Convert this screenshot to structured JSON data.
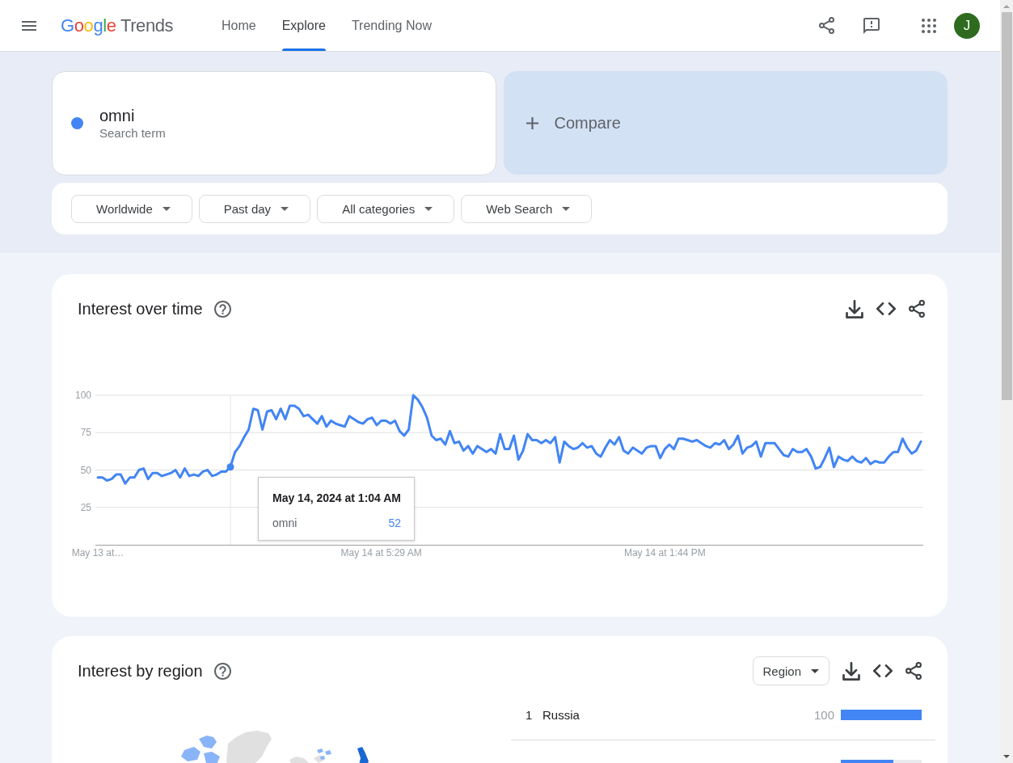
{
  "header": {
    "logo": {
      "brand": "Google",
      "product": "Trends"
    },
    "tabs": [
      {
        "label": "Home",
        "selected": false
      },
      {
        "label": "Explore",
        "selected": true
      },
      {
        "label": "Trending Now",
        "selected": false
      }
    ],
    "avatar": {
      "initial": "J"
    }
  },
  "search": {
    "terms": [
      {
        "term": "omni",
        "caption": "Search term",
        "color": "#4285f4"
      }
    ],
    "compare": {
      "label": "Compare"
    },
    "filters": [
      "Worldwide",
      "Past day",
      "All categories",
      "Web Search"
    ]
  },
  "interest_over_time": {
    "title": "Interest over time",
    "chart_data": {
      "type": "line",
      "grid": true,
      "categories": [
        "May 13 at…",
        null,
        null,
        null,
        null,
        null,
        null,
        null,
        null,
        null,
        null,
        null,
        null,
        null,
        null,
        null,
        null,
        null,
        null,
        null,
        null,
        null,
        null,
        null,
        null,
        null,
        null,
        null,
        null,
        null,
        null,
        null,
        null,
        null,
        null,
        null,
        null,
        null,
        null,
        null,
        null,
        null,
        null,
        null,
        null,
        null,
        null,
        null,
        null,
        null,
        null,
        null,
        null,
        null,
        null,
        null,
        null,
        null,
        null,
        null,
        null,
        null,
        "May 14 at 5:29 AM",
        null,
        null,
        null,
        null,
        null,
        null,
        null,
        null,
        null,
        null,
        null,
        null,
        null,
        null,
        null,
        null,
        null,
        null,
        null,
        null,
        null,
        null,
        null,
        null,
        null,
        null,
        null,
        null,
        null,
        null,
        null,
        null,
        null,
        null,
        null,
        null,
        null,
        null,
        null,
        null,
        null,
        null,
        null,
        null,
        null,
        null,
        null,
        null,
        null,
        null,
        null,
        null,
        null,
        null,
        null,
        null,
        null,
        null,
        null,
        null,
        null,
        "May 14 at 1:44 PM",
        null,
        null,
        null,
        null,
        null,
        null,
        null,
        null,
        null,
        null,
        null,
        null,
        null,
        null,
        null,
        null,
        null,
        null,
        null,
        null,
        null,
        null,
        null,
        null,
        null,
        null,
        null,
        null,
        null,
        null,
        null,
        null,
        null,
        null,
        null,
        null,
        null,
        null,
        null,
        null,
        null,
        null,
        null,
        null,
        null,
        null,
        null,
        null,
        null,
        null,
        null,
        null,
        null,
        null,
        null,
        null
      ],
      "series": [
        {
          "name": "omni",
          "color": "#4285f4",
          "values": [
            45,
            45,
            43,
            44,
            47,
            47,
            41,
            45,
            45,
            50,
            51,
            44,
            48,
            48,
            46,
            47,
            48,
            50,
            45,
            51,
            46,
            47,
            46,
            49,
            50,
            46,
            47,
            49,
            49,
            52,
            62,
            66,
            72,
            77,
            91,
            90,
            77,
            89,
            90,
            84,
            91,
            84,
            93,
            93,
            91,
            86,
            87,
            84,
            81,
            86,
            79,
            83,
            81,
            80,
            79,
            86,
            84,
            82,
            81,
            84,
            85,
            80,
            83,
            83,
            81,
            83,
            76,
            73,
            77,
            100,
            97,
            92,
            85,
            73,
            70,
            71,
            67,
            76,
            68,
            69,
            63,
            66,
            61,
            66,
            64,
            62,
            64,
            61,
            74,
            64,
            64,
            73,
            57,
            63,
            74,
            70,
            70,
            68,
            70,
            68,
            72,
            55,
            69,
            66,
            64,
            65,
            68,
            65,
            66,
            61,
            59,
            65,
            70,
            67,
            72,
            63,
            61,
            65,
            63,
            61,
            65,
            66,
            66,
            58,
            64,
            67,
            64,
            71,
            71,
            70,
            69,
            70,
            68,
            66,
            65,
            68,
            67,
            70,
            64,
            67,
            73,
            61,
            65,
            66,
            69,
            59,
            68,
            68,
            68,
            64,
            60,
            59,
            64,
            62,
            62,
            64,
            59,
            51,
            52,
            58,
            65,
            52,
            59,
            57,
            56,
            59,
            56,
            55,
            58,
            54,
            56,
            55,
            55,
            59,
            62,
            62,
            71,
            65,
            61,
            63,
            69
          ]
        }
      ],
      "ylim": [
        0,
        100
      ],
      "yticks": [
        25,
        50,
        75,
        100
      ]
    },
    "tooltip": {
      "date": "May 14, 2024 at 1:04 AM",
      "value": "52"
    }
  },
  "interest_by_region": {
    "title": "Interest by region",
    "resolution": "Region",
    "rows": [
      {
        "rank": "1",
        "name": "Russia",
        "value": "100",
        "level": 1
      },
      {
        "level": 0.65
      }
    ]
  }
}
